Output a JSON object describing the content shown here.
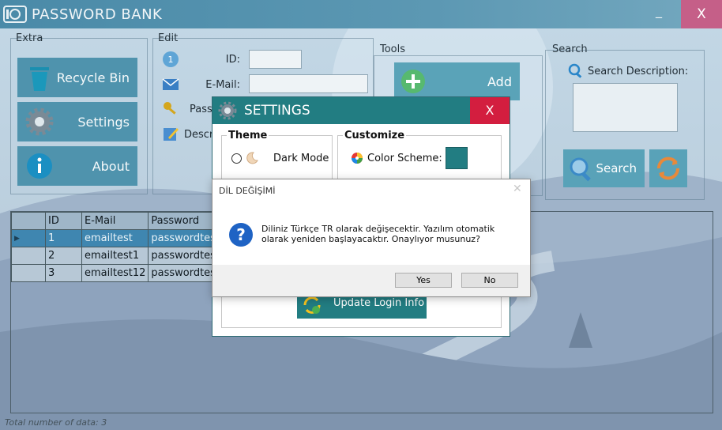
{
  "app": {
    "title": "PASSWORD BANK",
    "minimize_label": "_",
    "close_label": "X"
  },
  "extra": {
    "group_label": "Extra",
    "recycle_bin_label": "Recycle Bin",
    "settings_label": "Settings",
    "about_label": "About"
  },
  "edit": {
    "group_label": "Edit",
    "id_label": "ID:",
    "email_label": "E-Mail:",
    "password_label": "Pass",
    "description_label": "Descri",
    "id_value": "",
    "email_value": ""
  },
  "tools": {
    "group_label": "Tools",
    "add_label": "Add"
  },
  "search": {
    "group_label": "Search",
    "description_label": "Search Description:",
    "button_label": "Search",
    "query": ""
  },
  "table": {
    "columns": [
      "",
      "ID",
      "E-Mail",
      "Password"
    ],
    "rows": [
      {
        "id": "1",
        "email": "emailtest",
        "password": "passwordtest"
      },
      {
        "id": "2",
        "email": "emailtest1",
        "password": "passwordtest1"
      },
      {
        "id": "3",
        "email": "emailtest12",
        "password": "passwordtest12"
      }
    ]
  },
  "status": {
    "total_text": "Total number of data: 3"
  },
  "settings": {
    "title": "SETTINGS",
    "close_label": "X",
    "theme_label": "Theme",
    "dark_mode_label": "Dark Mode",
    "customize_label": "Customize",
    "color_scheme_label": "Color Scheme:",
    "color_scheme_value": "#227d82",
    "update_label": "Update Login Info"
  },
  "dialog": {
    "title": "DİL DEĞİŞİMİ",
    "close_label": "✕",
    "message": "Diliniz Türkçe TR olarak değişecektir. Yazılım otomatik olarak yeniden başlayacaktır. Onaylıyor musunuz?",
    "yes_label": "Yes",
    "no_label": "No"
  },
  "colors": {
    "accent": "#227d82",
    "titlebar": "#5c98b3",
    "app_close": "#c55f88",
    "settings_close": "#d31e3f"
  }
}
